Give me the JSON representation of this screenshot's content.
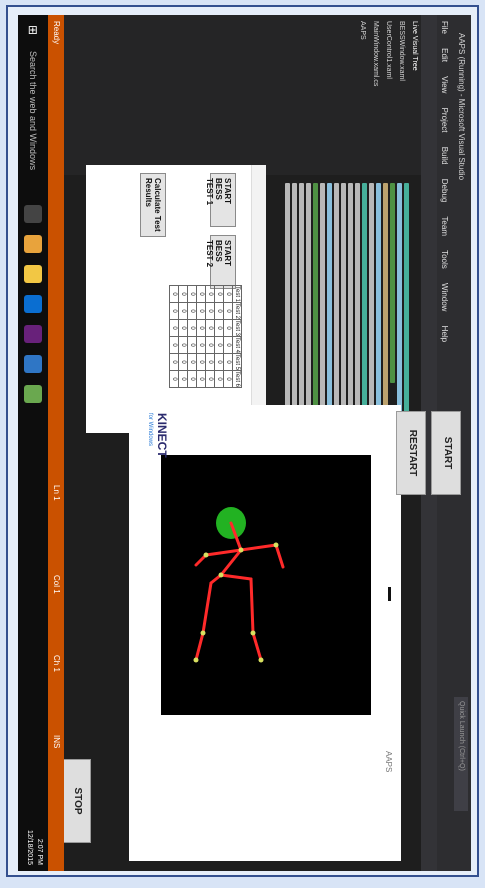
{
  "vs": {
    "title": "AAPS (Running) - Microsoft Visual Studio",
    "menu": [
      "File",
      "Edit",
      "View",
      "Project",
      "Build",
      "Debug",
      "Team",
      "Tools",
      "Window",
      "Help"
    ],
    "quick_launch": "Quick Launch (Ctrl+Q)",
    "live_tree": "Live Visual Tree",
    "tree_items": [
      "BESSWindow.xaml",
      "UserControl1.xaml",
      "MainWindow.xaml.cs",
      "AAPS"
    ]
  },
  "status": {
    "left": "Ready",
    "ln": "Ln 1",
    "col": "Col 1",
    "ch": "Ch 1",
    "ins": "INS"
  },
  "taskbar": {
    "search": "Search the web and Windows",
    "time": "2:07 PM",
    "date": "12/18/2015"
  },
  "form": {
    "btn_test1": "START BESS TEST 1",
    "btn_test2": "START BESS TEST 2",
    "btn_calc": "Calculate Test Results",
    "grid_headers": [
      "Test 1",
      "Test 2",
      "Test 3",
      "Test 4",
      "Test 5",
      "Test 6"
    ],
    "grid_rows": [
      [
        "0",
        "0",
        "0",
        "0",
        "0",
        "0"
      ],
      [
        "0",
        "0",
        "0",
        "0",
        "0",
        "0"
      ],
      [
        "0",
        "0",
        "0",
        "0",
        "0",
        "0"
      ],
      [
        "0",
        "0",
        "0",
        "0",
        "0",
        "0"
      ],
      [
        "0",
        "0",
        "0",
        "0",
        "0",
        "0"
      ],
      [
        "0",
        "0",
        "0",
        "0",
        "0",
        "0"
      ],
      [
        "0",
        "0",
        "0",
        "0",
        "0",
        "0"
      ]
    ]
  },
  "kinect_window": {
    "title": "AAPS",
    "btn_start": "START",
    "btn_restart": "RESTART",
    "btn_stop": "STOP",
    "logo": "KINECT",
    "logo_sub": "for Windows"
  },
  "colors": {
    "status_orange": "#ca5100",
    "skeleton_red": "#ff2a2a",
    "head_green": "#22b222"
  }
}
